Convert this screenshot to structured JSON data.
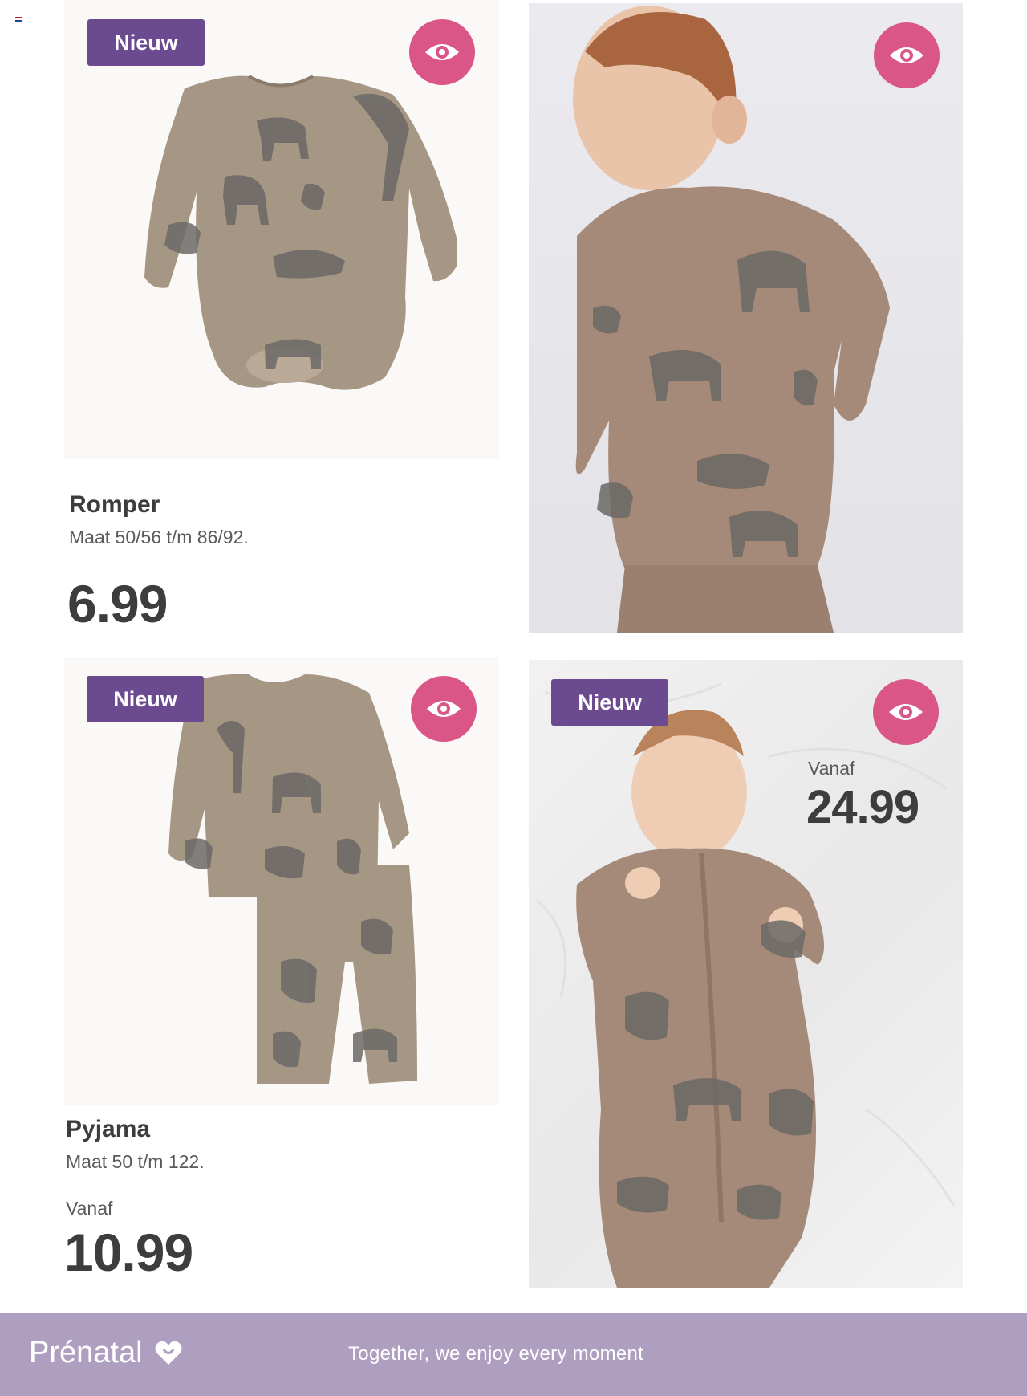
{
  "badges": {
    "new_label": "Nieuw"
  },
  "icons": {
    "eye": "eye-icon",
    "heart": "heart-logo-icon",
    "flag": "flag-icon"
  },
  "colors": {
    "badge": "#6b4a8f",
    "eye_button": "#d95686",
    "footer": "#ae9fc0"
  },
  "products": [
    {
      "title": "Romper",
      "sizes": "Maat 50/56 t/m 86/92.",
      "price": "6.99"
    },
    {
      "title": "Pyjama",
      "sizes": "Maat 50 t/m 122.",
      "price_prefix": "Vanaf",
      "price": "10.99"
    },
    {
      "price_prefix": "Vanaf",
      "price": "24.99"
    }
  ],
  "footer": {
    "brand": "Prénatal",
    "tagline": "Together, we enjoy every moment"
  }
}
